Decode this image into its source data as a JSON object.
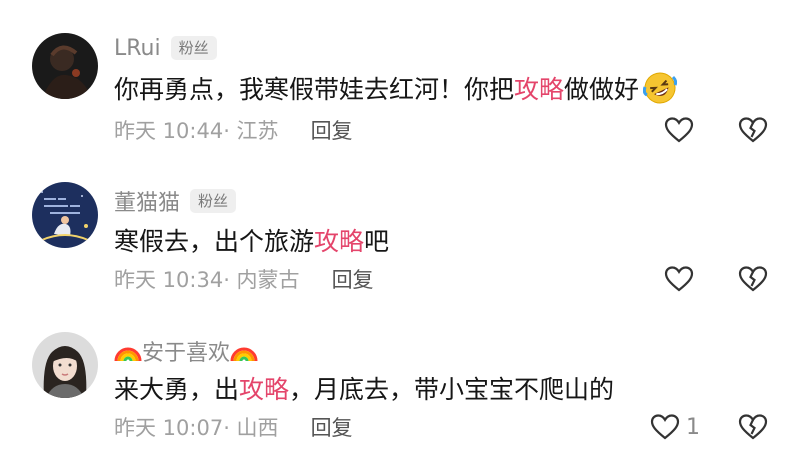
{
  "comments": [
    {
      "username": "LRui",
      "badge": "粉丝",
      "text_before": "你再勇点，我寒假带娃去红河！你把",
      "highlight": "攻略",
      "text_after": "做做好",
      "emoji": "rolling-on-floor-laughing",
      "time": "昨天 10:44",
      "location": "· 江苏",
      "reply_label": "回复",
      "likes": ""
    },
    {
      "username": "董猫猫",
      "badge": "粉丝",
      "text_before": "寒假去，出个旅游",
      "highlight": "攻略",
      "text_after": "吧",
      "time": "昨天 10:34",
      "location": "· 内蒙古",
      "reply_label": "回复",
      "likes": ""
    },
    {
      "username": "安于喜欢",
      "badge": "",
      "text_before": "来大勇，出",
      "highlight": "攻略",
      "text_after": "，月底去，带小宝宝不爬山的",
      "time": "昨天 10:07",
      "location": "· 山西",
      "reply_label": "回复",
      "likes": "1"
    }
  ],
  "icons": {
    "like": "heart-outline-icon",
    "dislike": "broken-heart-icon"
  },
  "colors": {
    "highlight": "#e4456b",
    "meta": "#a0a0a0",
    "name": "#8a8a8a"
  }
}
